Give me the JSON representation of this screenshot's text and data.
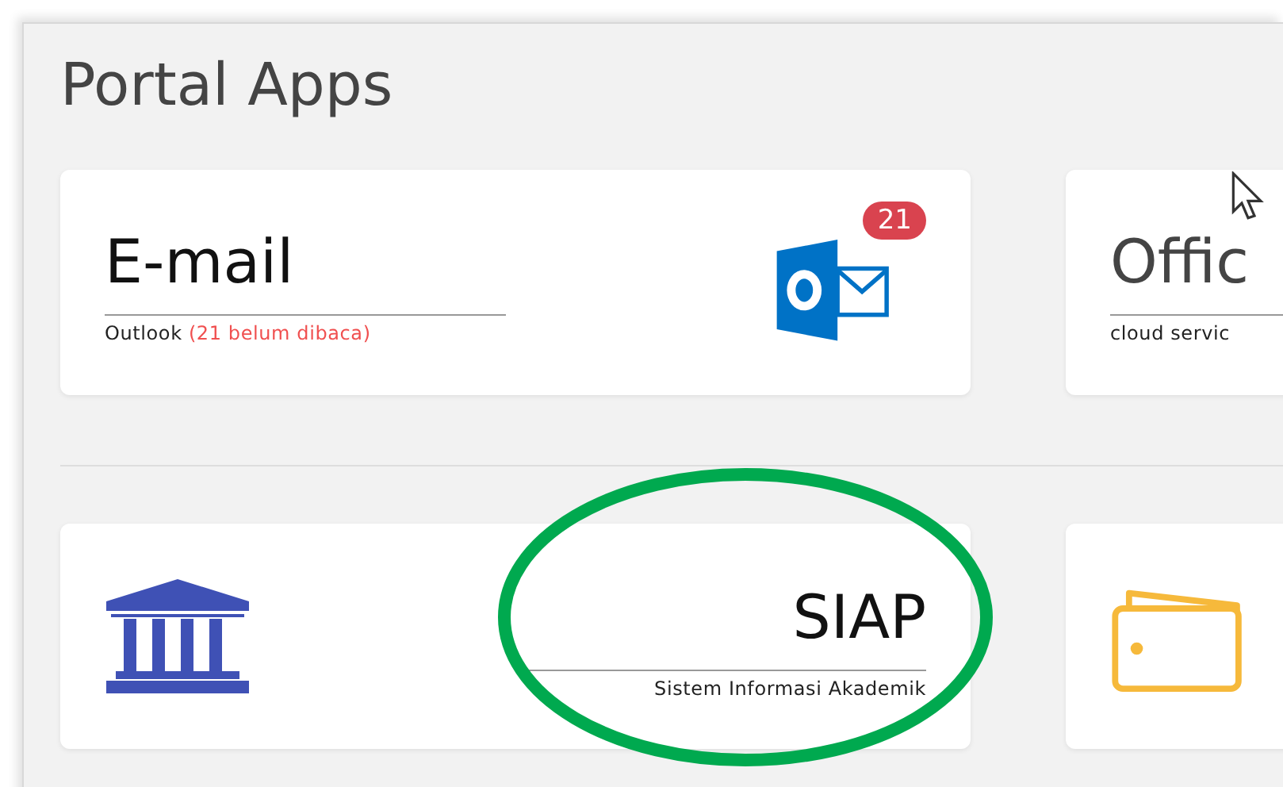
{
  "title": "Portal Apps",
  "rows": [
    {
      "cards": [
        {
          "kind": "text-first",
          "title": "E-mail",
          "subtitle": "Outlook",
          "note": "(21 belum dibaca)",
          "badge": "21"
        },
        {
          "kind": "text-first",
          "title": "Offic",
          "subtitle": "cloud servic"
        }
      ]
    },
    {
      "cards": [
        {
          "kind": "icon-first",
          "title": "SIAP",
          "subtitle": "Sistem Informasi Akademik"
        },
        {
          "kind": "icon-first"
        }
      ]
    }
  ],
  "highlight": {
    "kind": "ellipse"
  },
  "cursor": {
    "kind": "arrow"
  }
}
